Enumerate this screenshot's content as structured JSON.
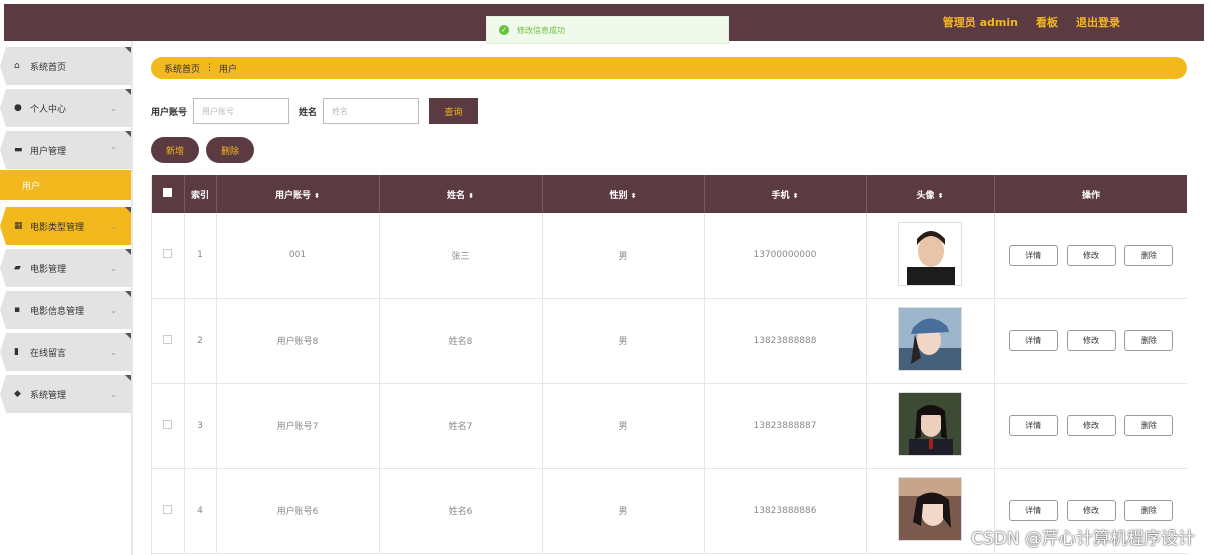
{
  "header": {
    "admin_label": "管理员 admin",
    "board_label": "看板",
    "logout_label": "退出登录"
  },
  "toast": {
    "message": "修改信息成功"
  },
  "sidebar": {
    "items": [
      {
        "label": "系统首页",
        "icon": "home-icon"
      },
      {
        "label": "个人中心",
        "icon": "user-icon"
      },
      {
        "label": "用户管理",
        "icon": "monitor-icon"
      },
      {
        "label": "用户",
        "icon": ""
      },
      {
        "label": "电影类型管理",
        "icon": "grid-icon"
      },
      {
        "label": "电影管理",
        "icon": "briefcase-icon"
      },
      {
        "label": "电影信息管理",
        "icon": "comment-icon"
      },
      {
        "label": "在线留言",
        "icon": "bar-chart-icon"
      },
      {
        "label": "系统管理",
        "icon": "settings-icon"
      }
    ]
  },
  "breadcrumb": {
    "home": "系统首页",
    "current": "用户"
  },
  "search": {
    "account_label": "用户账号",
    "account_placeholder": "用户账号",
    "name_label": "姓名",
    "name_placeholder": "姓名",
    "query_label": "查询"
  },
  "actions": {
    "add_label": "新增",
    "delete_label": "删除"
  },
  "table": {
    "headers": {
      "index": "索引",
      "account": "用户账号",
      "name": "姓名",
      "gender": "性别",
      "phone": "手机",
      "avatar": "头像",
      "ops": "操作"
    },
    "sort_icon": "sort-icon",
    "rows": [
      {
        "index": "1",
        "account": "001",
        "name": "张三",
        "gender": "男",
        "phone": "13700000000"
      },
      {
        "index": "2",
        "account": "用户账号8",
        "name": "姓名8",
        "gender": "男",
        "phone": "13823888888"
      },
      {
        "index": "3",
        "account": "用户账号7",
        "name": "姓名7",
        "gender": "男",
        "phone": "13823888887"
      },
      {
        "index": "4",
        "account": "用户账号6",
        "name": "姓名6",
        "gender": "男",
        "phone": "13823888886"
      }
    ],
    "op_labels": {
      "detail": "详情",
      "edit": "修改",
      "delete": "删除"
    }
  },
  "watermark": "CSDN @芹心计算机程序设计",
  "colors": {
    "primary": "#5b3a42",
    "accent": "#f2b81d",
    "success": "#67c23a"
  }
}
